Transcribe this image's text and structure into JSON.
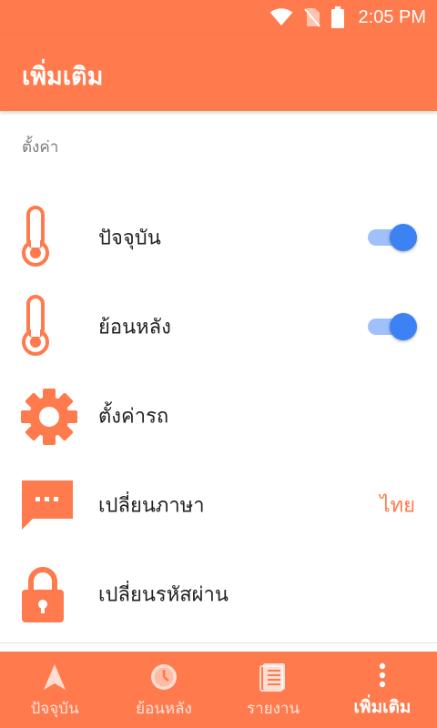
{
  "statusbar": {
    "time": "2:05 PM",
    "icons": [
      "wifi-icon",
      "no-sim-icon",
      "battery-icon"
    ]
  },
  "appbar": {
    "title": "เพิ่มเติม"
  },
  "settings": {
    "section_label": "ตั้งค่า",
    "items": [
      {
        "icon": "thermometer-icon",
        "label": "ปัจจุบัน",
        "toggle_on": true
      },
      {
        "icon": "thermometer-icon",
        "label": "ย้อนหลัง",
        "toggle_on": true
      },
      {
        "icon": "gear-icon",
        "label": "ตั้งค่ารถ"
      },
      {
        "icon": "chat-icon",
        "label": "เปลี่ยนภาษา",
        "value": "ไทย"
      },
      {
        "icon": "lock-icon",
        "label": "เปลี่ยนรหัสผ่าน"
      }
    ]
  },
  "bottom_nav": {
    "items": [
      {
        "icon": "navigation-arrow-icon",
        "label": "ปัจจุบัน"
      },
      {
        "icon": "clock-icon",
        "label": "ย้อนหลัง"
      },
      {
        "icon": "report-icon",
        "label": "รายงาน"
      },
      {
        "icon": "more-vertical-icon",
        "label": "เพิ่มเติม",
        "active": true
      }
    ]
  },
  "colors": {
    "accent": "#ff7a4d",
    "toggle_thumb": "#3d82f5",
    "toggle_track": "#9fc0fb"
  }
}
